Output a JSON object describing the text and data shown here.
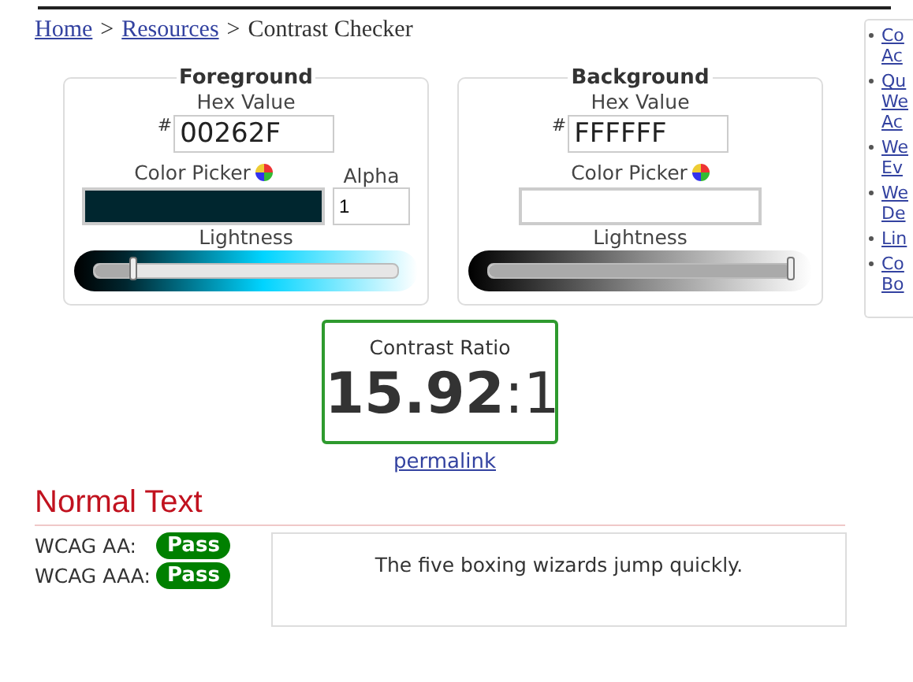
{
  "breadcrumb": [
    {
      "label": "Home",
      "link": true
    },
    {
      "label": ">",
      "link": false
    },
    {
      "label": "Resources",
      "link": true
    },
    {
      "label": ">",
      "link": false
    },
    {
      "label": "Contrast Checker",
      "link": false
    }
  ],
  "panels": [
    {
      "title": "Foreground",
      "hex_label": "Hex Value",
      "hash": "#",
      "hex": "00262F",
      "picker_label": "Color Picker",
      "alpha_label": "Alpha",
      "alpha": "1",
      "lightness_label": "Lightness",
      "level": 0.13,
      "kind": "foreground"
    },
    {
      "title": "Background",
      "hex_label": "Hex Value",
      "hash": "#",
      "hex": "FFFFFF",
      "picker_label": "Color Picker",
      "lightness_label": "Lightness",
      "level": 1,
      "kind": "background"
    }
  ],
  "contrast": {
    "label": "Contrast Ratio",
    "ratio": "15.92",
    "suffix": ":1"
  },
  "permalink": "permalink",
  "normal_text": {
    "heading": "Normal Text",
    "results": [
      {
        "label": "WCAG AA:",
        "result": "Pass"
      },
      {
        "label": "WCAG AAA:",
        "result": "Pass"
      }
    ],
    "sample": "The five boxing wizards jump quickly."
  },
  "sidebar": {
    "items": [
      {
        "lines": [
          "Co",
          "Ac"
        ]
      },
      {
        "lines": [
          "Qu",
          "We",
          "Ac"
        ]
      },
      {
        "lines": [
          "We",
          "Ev"
        ]
      },
      {
        "lines": [
          "We",
          "De"
        ]
      },
      {
        "lines": [
          "Lin"
        ]
      },
      {
        "lines": [
          "Co",
          "Bo"
        ]
      }
    ]
  }
}
